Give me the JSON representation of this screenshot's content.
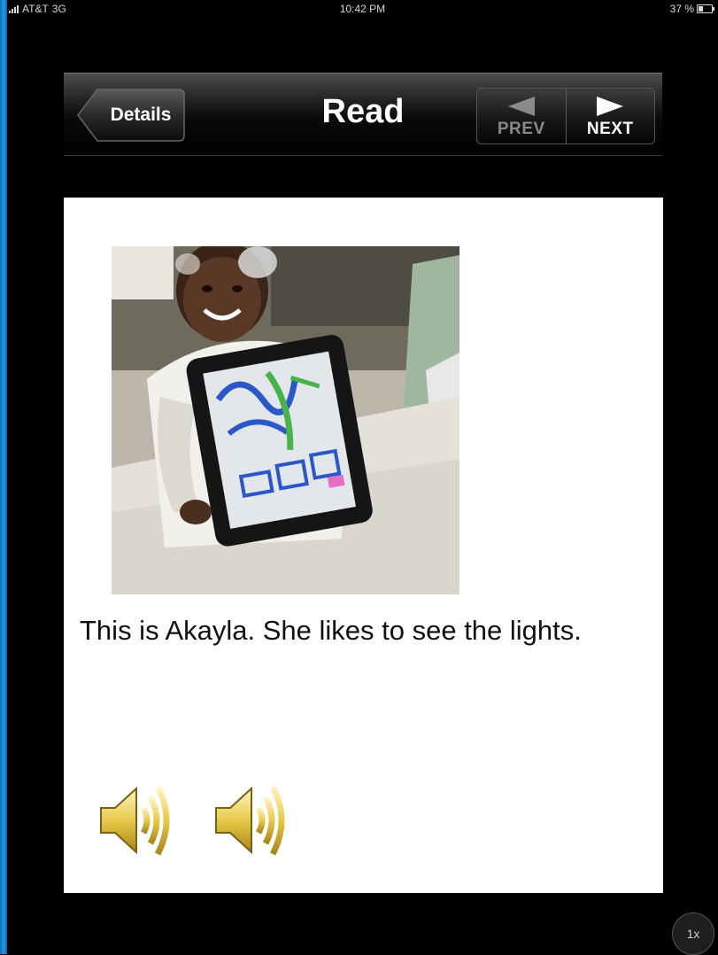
{
  "status_bar": {
    "carrier": "AT&T",
    "network": "3G",
    "time": "10:42 PM",
    "battery_percent": "37 %"
  },
  "nav": {
    "back_label": "Details",
    "title": "Read",
    "prev_label": "PREV",
    "next_label": "NEXT"
  },
  "page": {
    "photo_icon": "photo-child-with-tablet-drawing",
    "caption": "This is Akayla. She likes to see the lights.",
    "audio_buttons": [
      {
        "icon": "speaker-icon"
      },
      {
        "icon": "speaker-icon"
      }
    ]
  },
  "playback": {
    "speed": "1x"
  },
  "colors": {
    "background": "#000000",
    "card": "#ffffff",
    "speaker_gold": "#e8c94a"
  }
}
